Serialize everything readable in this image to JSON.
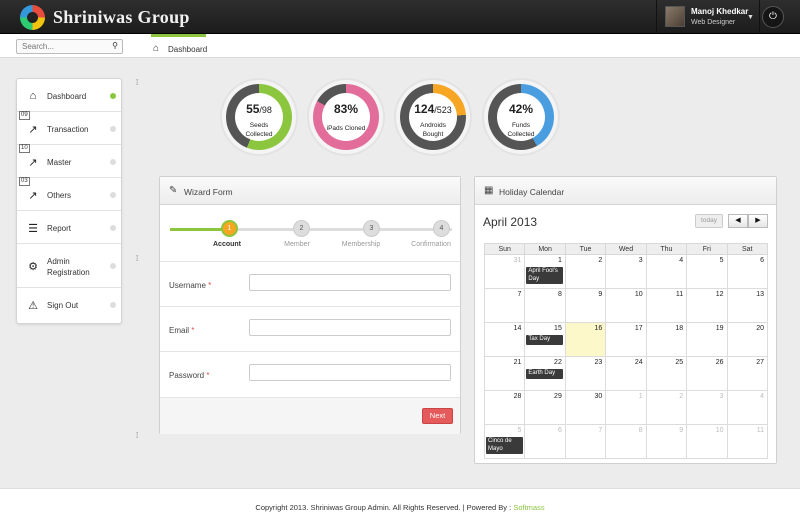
{
  "header": {
    "brand": "Shriniwas Group",
    "user_name": "Manoj Khedkar",
    "user_role": "Web Designer",
    "caret": "▼",
    "power": "⏻"
  },
  "search": {
    "placeholder": "Search..."
  },
  "breadcrumb": {
    "label": "Dashboard"
  },
  "sidebar": {
    "items": [
      {
        "label": "Dashboard",
        "icon": "home-icon",
        "glyph": "⌂",
        "active": true
      },
      {
        "label": "Transaction",
        "icon": "chart-line-icon",
        "glyph": "📈",
        "badge": "09"
      },
      {
        "label": "Master",
        "icon": "chart-line-icon",
        "glyph": "📈",
        "badge": "10"
      },
      {
        "label": "Others",
        "icon": "chart-line-icon",
        "glyph": "📈",
        "badge": "03"
      },
      {
        "label": "Report",
        "icon": "sliders-icon",
        "glyph": "☰"
      },
      {
        "label_line1": "Admin",
        "label_line2": "Registration",
        "icon": "gear-icon",
        "glyph": "⚙"
      },
      {
        "label": "Sign Out",
        "icon": "warning-icon",
        "glyph": "⚠"
      }
    ]
  },
  "stats": [
    {
      "value": "55",
      "total": "/98",
      "caption_1": "Seeds",
      "caption_2": "Collected",
      "percent": 56,
      "color": "#8cc63f"
    },
    {
      "value": "83%",
      "total": "",
      "caption_1": "iPads Cloned",
      "caption_2": "",
      "percent": 83,
      "color": "#e26d9b"
    },
    {
      "value": "124",
      "total": "/523",
      "caption_1": "Androids",
      "caption_2": "Bought",
      "percent": 24,
      "color": "#f6a623"
    },
    {
      "value": "42%",
      "total": "",
      "caption_1": "Funds",
      "caption_2": "Collected",
      "percent": 42,
      "color": "#4a9ee0"
    }
  ],
  "wizard": {
    "title": "Wizard Form",
    "steps": [
      {
        "num": "1",
        "label": "Account"
      },
      {
        "num": "2",
        "label": "Member"
      },
      {
        "num": "3",
        "label": "Membership"
      },
      {
        "num": "4",
        "label": "Confirmation"
      }
    ],
    "fields": [
      {
        "label": "Username",
        "required": "*",
        "value": ""
      },
      {
        "label": "Email",
        "required": "*",
        "value": ""
      },
      {
        "label": "Password",
        "required": "*",
        "value": ""
      }
    ],
    "next_label": "Next"
  },
  "calendar": {
    "title": "Holiday Calendar",
    "month": "April 2013",
    "today_label": "today",
    "prev": "◀",
    "next": "▶",
    "weekdays": [
      "Sun",
      "Mon",
      "Tue",
      "Wed",
      "Thu",
      "Fri",
      "Sat"
    ],
    "weeks": [
      [
        {
          "d": "31",
          "o": true
        },
        {
          "d": "1",
          "e": "April Fool's Day"
        },
        {
          "d": "2"
        },
        {
          "d": "3"
        },
        {
          "d": "4"
        },
        {
          "d": "5"
        },
        {
          "d": "6"
        }
      ],
      [
        {
          "d": "7"
        },
        {
          "d": "8"
        },
        {
          "d": "9"
        },
        {
          "d": "10"
        },
        {
          "d": "11"
        },
        {
          "d": "12"
        },
        {
          "d": "13"
        }
      ],
      [
        {
          "d": "14"
        },
        {
          "d": "15",
          "e": "Tax Day"
        },
        {
          "d": "16",
          "t": true
        },
        {
          "d": "17"
        },
        {
          "d": "18"
        },
        {
          "d": "19"
        },
        {
          "d": "20"
        }
      ],
      [
        {
          "d": "21"
        },
        {
          "d": "22",
          "e": "Earth Day"
        },
        {
          "d": "23"
        },
        {
          "d": "24"
        },
        {
          "d": "25"
        },
        {
          "d": "26"
        },
        {
          "d": "27"
        }
      ],
      [
        {
          "d": "28"
        },
        {
          "d": "29"
        },
        {
          "d": "30"
        },
        {
          "d": "1",
          "o": true
        },
        {
          "d": "2",
          "o": true
        },
        {
          "d": "3",
          "o": true
        },
        {
          "d": "4",
          "o": true
        }
      ],
      [
        {
          "d": "5",
          "o": true,
          "e": "Cinco de Mayo"
        },
        {
          "d": "6",
          "o": true
        },
        {
          "d": "7",
          "o": true
        },
        {
          "d": "8",
          "o": true
        },
        {
          "d": "9",
          "o": true
        },
        {
          "d": "10",
          "o": true
        },
        {
          "d": "11",
          "o": true
        }
      ]
    ]
  },
  "footer": {
    "text": "Copyright 2013. Shriniwas Group Admin. All Rights Reserved. | Powered By : ",
    "link": "Softmass"
  },
  "colors": {
    "accent": "#8cc63f",
    "button": "#e55a5a"
  }
}
